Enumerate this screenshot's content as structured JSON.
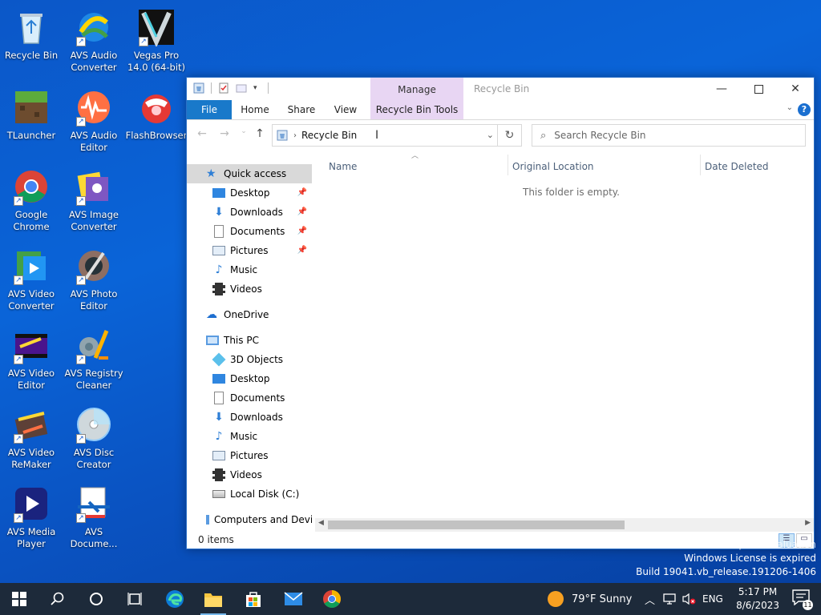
{
  "desktop": {
    "icons": [
      {
        "label": "Recycle Bin"
      },
      {
        "label": "AVS Audio Converter"
      },
      {
        "label": "Vegas Pro 14.0 (64-bit)"
      },
      {
        "label": "TLauncher"
      },
      {
        "label": "AVS Audio Editor"
      },
      {
        "label": "FlashBrowser"
      },
      {
        "label": "Google Chrome"
      },
      {
        "label": "AVS Image Converter"
      },
      {
        "label": "AVS Video Converter"
      },
      {
        "label": "AVS Photo Editor"
      },
      {
        "label": "AVS Video Editor"
      },
      {
        "label": "AVS Registry Cleaner"
      },
      {
        "label": "AVS Video ReMaker"
      },
      {
        "label": "AVS Disc Creator"
      },
      {
        "label": "AVS Media Player"
      },
      {
        "label": "AVS Docume..."
      }
    ]
  },
  "window": {
    "title": "Recycle Bin",
    "manage_tab": "Manage",
    "ribbon_tabs": [
      "File",
      "Home",
      "Share",
      "View",
      "Recycle Bin Tools"
    ],
    "address": {
      "path": "Recycle Bin"
    },
    "search": {
      "placeholder": "Search Recycle Bin"
    },
    "nav": {
      "quick_access": "Quick access",
      "quick_items": [
        "Desktop",
        "Downloads",
        "Documents",
        "Pictures",
        "Music",
        "Videos"
      ],
      "onedrive": "OneDrive",
      "this_pc": "This PC",
      "pc_items": [
        "3D Objects",
        "Desktop",
        "Documents",
        "Downloads",
        "Music",
        "Pictures",
        "Videos",
        "Local Disk (C:)"
      ],
      "network": "Computers and Devic"
    },
    "columns": [
      "Name",
      "Original Location",
      "Date Deleted"
    ],
    "empty_text": "This folder is empty.",
    "status": "0 items"
  },
  "watermark": {
    "line1": "Windows 10 Enterprise Evaluation",
    "line2": "Windows License is expired",
    "line3": "Build 19041.vb_release.191206-1406"
  },
  "taskbar": {
    "weather": "79°F  Sunny",
    "language": "ENG",
    "time": "5:17 PM",
    "date": "8/6/2023",
    "notification_count": "11"
  },
  "colors": {
    "accent": "#1979ca",
    "manage_bg": "#e8d6f3",
    "desktop": "#0a5ccc",
    "taskbar": "#1d2a3a"
  }
}
